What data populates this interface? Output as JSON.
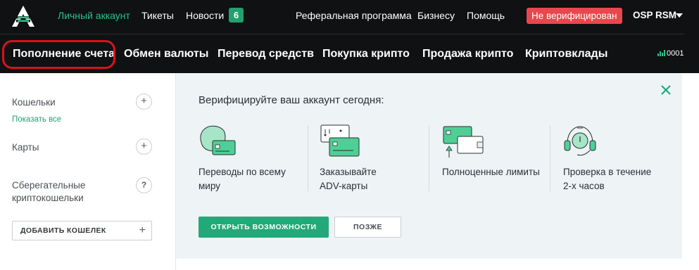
{
  "header": {
    "nav": [
      {
        "label": "Личный аккаунт",
        "active": true
      },
      {
        "label": "Тикеты",
        "active": false
      },
      {
        "label": "Новости",
        "active": false
      }
    ],
    "news_count": "6",
    "right_nav": [
      {
        "label": "Реферальная программа"
      },
      {
        "label": "Бизнесу"
      },
      {
        "label": "Помощь"
      }
    ],
    "verification_status": "Не верифицирован",
    "user_name": "OSP RSM"
  },
  "main_nav": {
    "items": [
      {
        "label": "Пополнение счета",
        "highlighted": true
      },
      {
        "label": "Обмен валюты"
      },
      {
        "label": "Перевод средств"
      },
      {
        "label": "Покупка крипто"
      },
      {
        "label": "Продажа крипто"
      },
      {
        "label": "Криптовклады"
      }
    ],
    "stat_value": "0001"
  },
  "sidebar": {
    "wallets_label": "Кошельки",
    "show_all_link": "Показать все",
    "cards_label": "Карты",
    "savings_label": "Сберегательные криптокошельки",
    "add_wallet_label": "ДОБАВИТЬ КОШЕЛЕК"
  },
  "promo": {
    "title": "Верифицируйте ваш аккаунт сегодня:",
    "features": [
      {
        "icon": "globe-card-icon",
        "text": "Переводы по всему\nмиру"
      },
      {
        "icon": "adv-cards-icon",
        "text": "Заказывайте\nADV-карты"
      },
      {
        "icon": "card-wallet-icon",
        "text": "Полноценные лимиты"
      },
      {
        "icon": "support-headset-icon",
        "text": "Проверка в течение\n2-х часов"
      }
    ],
    "primary_button": "ОТКРЫТЬ ВОЗМОЖНОСТИ",
    "secondary_button": "ПОЗЖЕ"
  },
  "colors": {
    "accent_green": "#23a87a",
    "header_bg": "#0f1113",
    "danger": "#e8474d",
    "panel_bg": "#eef3f6"
  }
}
